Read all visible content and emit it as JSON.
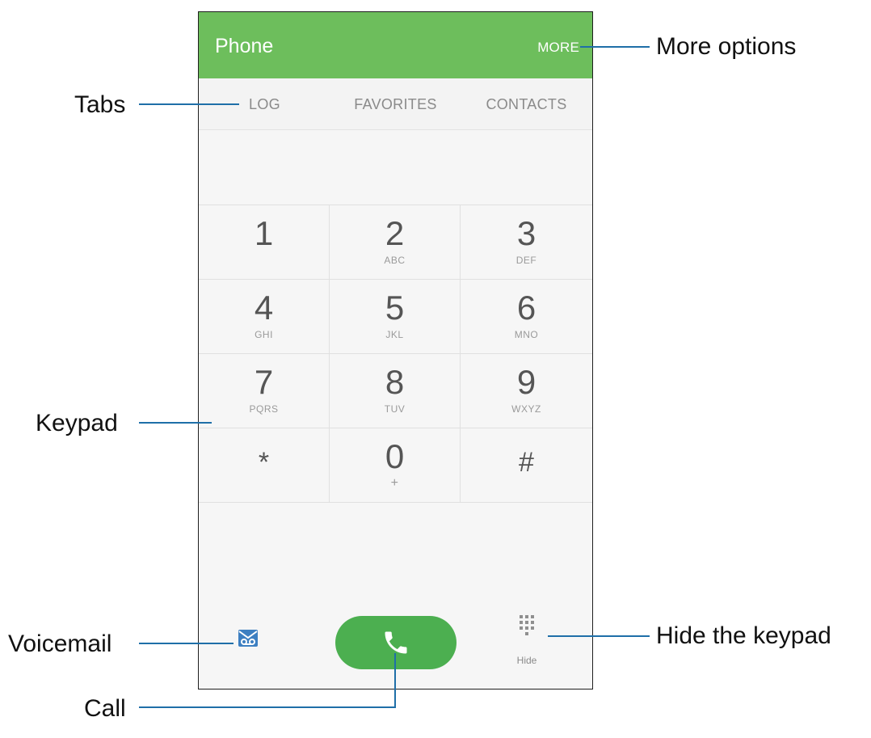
{
  "app_bar": {
    "title": "Phone",
    "more_label": "MORE",
    "color": "#6dbe5c"
  },
  "tabs": [
    {
      "label": "LOG"
    },
    {
      "label": "FAVORITES"
    },
    {
      "label": "CONTACTS"
    }
  ],
  "number_display": {
    "value": ""
  },
  "keypad": {
    "keys": [
      {
        "digit": "1",
        "letters": ""
      },
      {
        "digit": "2",
        "letters": "ABC"
      },
      {
        "digit": "3",
        "letters": "DEF"
      },
      {
        "digit": "4",
        "letters": "GHI"
      },
      {
        "digit": "5",
        "letters": "JKL"
      },
      {
        "digit": "6",
        "letters": "MNO"
      },
      {
        "digit": "7",
        "letters": "PQRS"
      },
      {
        "digit": "8",
        "letters": "TUV"
      },
      {
        "digit": "9",
        "letters": "WXYZ"
      },
      {
        "digit": "*",
        "letters": ""
      },
      {
        "digit": "0",
        "letters": "+"
      },
      {
        "digit": "#",
        "letters": ""
      }
    ]
  },
  "bottom_bar": {
    "voicemail_icon": "voicemail-icon",
    "call_icon": "phone-handset-icon",
    "call_color": "#4caf50",
    "hide_icon": "dialpad-icon",
    "hide_label": "Hide"
  },
  "callouts": {
    "more_options": "More options",
    "tabs": "Tabs",
    "keypad": "Keypad",
    "voicemail": "Voicemail",
    "hide_keypad": "Hide the keypad",
    "call": "Call",
    "line_color": "#1f6fa8"
  }
}
